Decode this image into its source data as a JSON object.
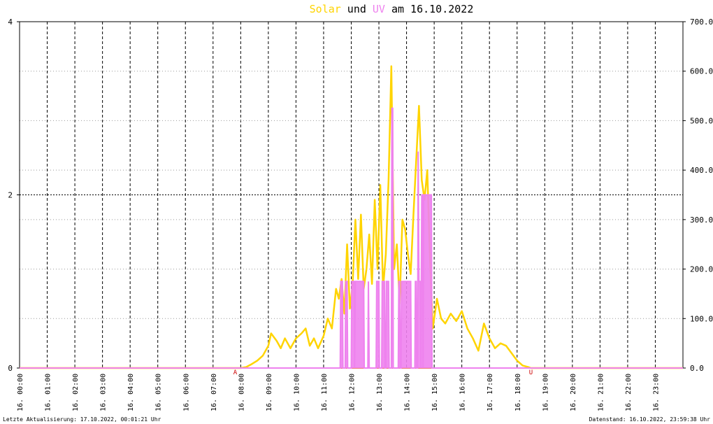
{
  "title": {
    "part1": "Solar",
    "part2": "und",
    "part3": "UV",
    "part4": "am 16.10.2022"
  },
  "footer": {
    "left": "Letzte Aktualisierung: 17.10.2022, 00:01:21 Uhr",
    "right": "Datenstand: 16.10.2022, 23:59:38 Uhr"
  },
  "colors": {
    "solar": "#ffd400",
    "uv": "#ee82ee",
    "baseline": "#f08080",
    "grid": "#000000",
    "background": "#ffffff"
  },
  "chart_data": {
    "type": "line",
    "grid": true,
    "x_unit": "hours since 16.10.2022 00:00",
    "x_range": [
      0,
      24
    ],
    "x_tick_labels": [
      "16. 00:00",
      "16. 01:00",
      "16. 02:00",
      "16. 03:00",
      "16. 04:00",
      "16. 05:00",
      "16. 06:00",
      "16. 07:00",
      "16. 08:00",
      "16. 09:00",
      "16. 10:00",
      "16. 11:00",
      "16. 12:00",
      "16. 13:00",
      "16. 14:00",
      "16. 15:00",
      "16. 16:00",
      "16. 17:00",
      "16. 18:00",
      "16. 19:00",
      "16. 20:00",
      "16. 21:00",
      "16. 22:00",
      "16. 23:00"
    ],
    "y_left": {
      "range": [
        0,
        4
      ],
      "tick_labels": [
        "0",
        "2",
        "4"
      ]
    },
    "y_right": {
      "range": [
        0,
        700
      ],
      "tick_labels": [
        "0.0",
        "100.0",
        "200.0",
        "300.0",
        "400.0",
        "500.0",
        "600.0",
        "700.0"
      ]
    },
    "sunrise_marker": {
      "x": 7.8,
      "label": "A"
    },
    "sunset_marker": {
      "x": 18.5,
      "label": "U"
    },
    "series": [
      {
        "name": "Solar",
        "axis": "right",
        "x": [
          0,
          8.0,
          8.2,
          8.4,
          8.6,
          8.8,
          9.0,
          9.1,
          9.3,
          9.45,
          9.6,
          9.8,
          10.0,
          10.2,
          10.35,
          10.5,
          10.65,
          10.8,
          11.0,
          11.15,
          11.3,
          11.45,
          11.55,
          11.65,
          11.75,
          11.85,
          11.95,
          12.05,
          12.15,
          12.25,
          12.35,
          12.45,
          12.55,
          12.65,
          12.75,
          12.85,
          12.95,
          13.05,
          13.15,
          13.25,
          13.35,
          13.45,
          13.55,
          13.65,
          13.75,
          13.85,
          13.95,
          14.05,
          14.15,
          14.25,
          14.35,
          14.45,
          14.55,
          14.65,
          14.75,
          14.85,
          14.95,
          15.1,
          15.25,
          15.4,
          15.6,
          15.8,
          16.0,
          16.2,
          16.4,
          16.6,
          16.8,
          17.0,
          17.2,
          17.4,
          17.6,
          17.8,
          18.0,
          18.2,
          18.4,
          18.5,
          24
        ],
        "values": [
          0,
          0,
          2,
          8,
          15,
          25,
          45,
          70,
          55,
          40,
          60,
          40,
          60,
          70,
          80,
          45,
          60,
          40,
          65,
          100,
          80,
          160,
          140,
          180,
          110,
          250,
          120,
          170,
          300,
          180,
          310,
          160,
          200,
          270,
          170,
          340,
          200,
          370,
          160,
          230,
          380,
          610,
          200,
          250,
          130,
          300,
          280,
          230,
          190,
          310,
          420,
          530,
          380,
          340,
          400,
          220,
          80,
          140,
          100,
          90,
          110,
          95,
          115,
          80,
          60,
          35,
          90,
          60,
          40,
          50,
          45,
          30,
          15,
          5,
          2,
          0,
          0
        ]
      },
      {
        "name": "UV",
        "axis": "left",
        "x": [
          0,
          11.6,
          11.62,
          11.68,
          11.7,
          11.72,
          11.78,
          11.8,
          11.85,
          11.87,
          11.9,
          12.0,
          12.02,
          12.1,
          12.12,
          12.15,
          12.45,
          12.47,
          12.6,
          12.62,
          12.65,
          12.9,
          12.92,
          12.95,
          13.0,
          13.02,
          13.05,
          13.1,
          13.12,
          13.2,
          13.22,
          13.25,
          13.27,
          13.3,
          13.35,
          13.37,
          13.45,
          13.47,
          13.5,
          13.52,
          13.55,
          13.7,
          13.72,
          13.75,
          13.77,
          13.8,
          13.82,
          14.15,
          14.17,
          14.3,
          14.32,
          14.35,
          14.37,
          14.4,
          14.42,
          14.45,
          14.5,
          14.52,
          14.55,
          14.58,
          14.6,
          14.62,
          14.65,
          14.9,
          14.92,
          24
        ],
        "values": [
          0,
          0,
          1,
          1,
          0,
          0,
          0,
          1,
          1,
          0,
          0,
          0,
          1,
          1,
          0,
          1,
          1,
          0,
          0,
          1,
          0,
          0,
          1,
          1,
          1,
          0,
          0,
          0,
          1,
          1,
          0,
          0,
          1,
          1,
          1,
          0,
          0,
          3,
          3,
          0,
          0,
          0,
          1,
          1,
          0,
          0,
          1,
          1,
          0,
          0,
          1,
          1,
          0,
          0,
          2.5,
          1,
          1,
          0,
          2,
          2,
          0,
          2,
          2,
          2,
          0,
          0
        ]
      }
    ]
  }
}
